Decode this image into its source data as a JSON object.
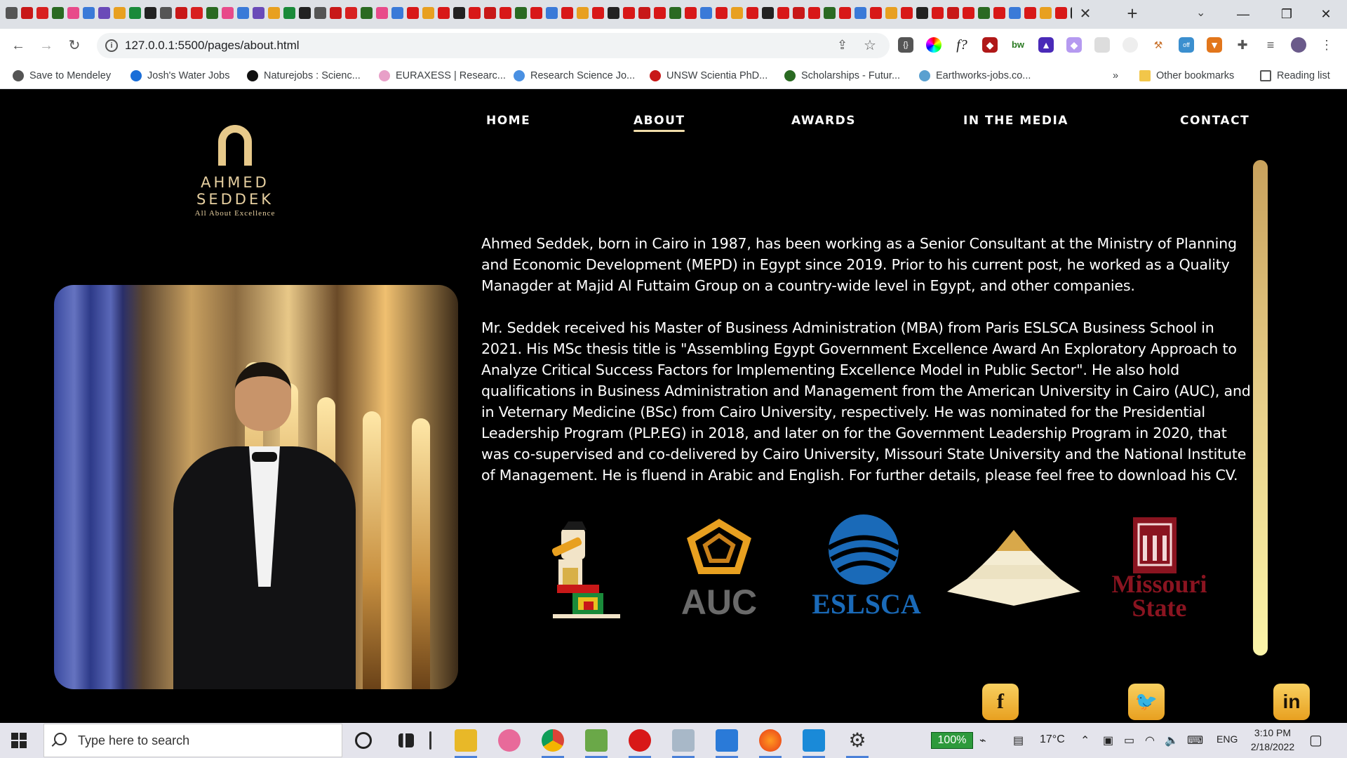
{
  "browser": {
    "url": "127.0.0.1:5500/pages/about.html",
    "bookmarks": [
      "Save to Mendeley",
      "Josh's Water Jobs",
      "Naturejobs : Scienc...",
      "EURAXESS | Researc...",
      "Research Science Jo...",
      "UNSW Scientia PhD...",
      "Scholarships - Futur...",
      "Earthworks-jobs.co...",
      "Other bookmarks",
      "Reading list"
    ],
    "overflow_chevron": "»"
  },
  "site": {
    "logo_name": "AHMED SEDDEK",
    "logo_tagline": "All About Excellence",
    "nav": [
      "HOME",
      "ABOUT",
      "AWARDS",
      "IN THE MEDIA",
      "CONTACT"
    ],
    "active_nav": "ABOUT",
    "bio": [
      "Ahmed Seddek, born in Cairo in 1987, has been working as a Senior Consultant at the Ministry of Planning and Economic Development (MEPD) in Egypt since 2019. Prior to his current post, he worked as a Quality Managder at Majid Al Futtaim Group on a country-wide level in Egypt, and other companies.",
      "Mr. Seddek received his Master of Business Administration (MBA) from Paris ESLSCA Business School in 2021. His MSc thesis title is \"Assembling Egypt Government Excellence Award An Exploratory Approach to Analyze Critical Success Factors for Implementing Excellence Model in Public Sector\". He also hold qualifications in Business Administration and Management from the American University in Cairo (AUC), and in Veternary Medicine (BSc) from Cairo University, respectively. He was nominated for the Presidential Leadership Program (PLP.EG) in 2018, and later on for the Government Leadership Program in 2020, that was co-supervised and co-delivered by Cairo University, Missouri State University and the National Institute of Management. He is fluend in Arabic and English. For further details, please feel free to download his CV."
    ],
    "partners": {
      "auc": "AUC",
      "eslsca": "ESLSCA",
      "missouri_line1": "Missouri",
      "missouri_line2": "State"
    },
    "social": [
      "facebook-icon",
      "twitter-icon",
      "linkedin-icon"
    ]
  },
  "taskbar": {
    "search_placeholder": "Type here to search",
    "battery": "100%",
    "temperature": "17°C",
    "language": "ENG",
    "time": "3:10 PM",
    "date": "2/18/2022"
  },
  "colors": {
    "gold": "#e7c98a",
    "page_bg": "#000000"
  }
}
